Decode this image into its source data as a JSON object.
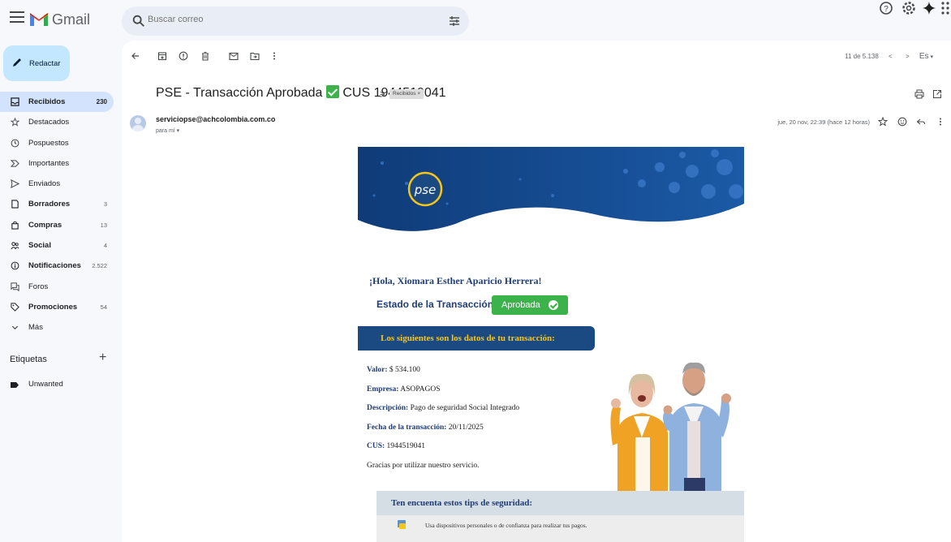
{
  "app": {
    "brand": "Gmail"
  },
  "search": {
    "placeholder": "Buscar correo"
  },
  "compose": {
    "label": "Redactar"
  },
  "nav": [
    {
      "id": "inbox",
      "label": "Recibidos",
      "count": "230",
      "bold": true,
      "active": true,
      "icon": "inbox-icon"
    },
    {
      "id": "starred",
      "label": "Destacados",
      "count": "",
      "bold": false,
      "icon": "star-icon"
    },
    {
      "id": "snoozed",
      "label": "Pospuestos",
      "count": "",
      "bold": false,
      "icon": "clock-icon"
    },
    {
      "id": "important",
      "label": "Importantes",
      "count": "",
      "bold": false,
      "icon": "important-icon"
    },
    {
      "id": "sent",
      "label": "Enviados",
      "count": "",
      "bold": false,
      "icon": "send-icon"
    },
    {
      "id": "drafts",
      "label": "Borradores",
      "count": "3",
      "bold": true,
      "icon": "draft-icon"
    },
    {
      "id": "purchases",
      "label": "Compras",
      "count": "13",
      "bold": true,
      "icon": "bag-icon"
    },
    {
      "id": "social",
      "label": "Social",
      "count": "4",
      "bold": true,
      "icon": "people-icon"
    },
    {
      "id": "updates",
      "label": "Notificaciones",
      "count": "2.522",
      "bold": true,
      "icon": "info-icon"
    },
    {
      "id": "forums",
      "label": "Foros",
      "count": "",
      "bold": false,
      "icon": "forum-icon"
    },
    {
      "id": "promotions",
      "label": "Promociones",
      "count": "54",
      "bold": true,
      "icon": "tag-icon"
    },
    {
      "id": "more",
      "label": "Más",
      "count": "",
      "bold": false,
      "icon": "chevron-down-icon"
    }
  ],
  "labels": {
    "title": "Etiquetas",
    "add": "+",
    "items": [
      {
        "label": "Unwanted"
      }
    ]
  },
  "toolbar": {
    "pager": "11 de 5.138",
    "lang": "Es"
  },
  "message": {
    "subject_pre": "PSE - Transacción Aprobada",
    "subject_post": "CUS 1944519041",
    "chip": "Recibidos ×",
    "sender": "serviciopse@achcolombia.com.co",
    "to": "para mí ▾",
    "date": "jue, 20 nov, 22:39 (hace 12 horas)"
  },
  "email": {
    "logo_text": "pse",
    "greeting": "¡Hola, Xiomara Esther Aparicio Herrera!",
    "estado_label": "Estado de la Transacción:",
    "estado_value": "Aprobada",
    "section_title": "Los siguientes son los datos de tu transacción:",
    "fields": [
      {
        "k": "Valor:",
        "v": "$ 534.100"
      },
      {
        "k": "Empresa:",
        "v": "ASOPAGOS"
      },
      {
        "k": "Descripción:",
        "v": "Pago de seguridad Social Integrado"
      },
      {
        "k": "Fecha de la transacción:",
        "v": "20/11/2025"
      },
      {
        "k": "CUS:",
        "v": "1944519041"
      }
    ],
    "thanks": "Gracias por utilizar nuestro servicio.",
    "tips_title": "Ten encuenta estos tips de seguridad:",
    "tip1": "Usa dispositivos personales o de confianza para realizar tus pagos."
  },
  "colors": {
    "compose_bg": "#c2e7ff",
    "active_bg": "#d3e3fd",
    "pse_blue": "#1b4a82",
    "gold": "#f5c518",
    "green": "#3bb24a"
  }
}
